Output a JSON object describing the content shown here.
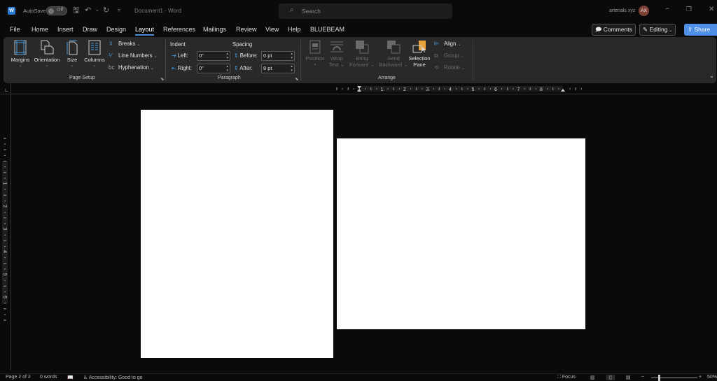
{
  "titlebar": {
    "app_logo": "W",
    "autosave_label": "AutoSave",
    "autosave_state": "Off",
    "save_icon": "save-icon",
    "undo_icon": "undo-icon",
    "redo_icon": "redo-icon",
    "customize_icon": "customize-qat-icon",
    "document_title": "Document1  -  Word",
    "search_placeholder": "Search",
    "username": "arterials xyz",
    "avatar_initials": "AX",
    "minimize_glyph": "−",
    "restore_glyph": "❐",
    "close_glyph": "✕"
  },
  "menu": {
    "tabs": [
      "File",
      "Home",
      "Insert",
      "Draw",
      "Design",
      "Layout",
      "References",
      "Mailings",
      "Review",
      "View",
      "Help",
      "BLUEBEAM"
    ],
    "active_tab": "Layout",
    "comments_label": "Comments",
    "editing_label": "Editing",
    "share_label": "Share"
  },
  "ribbon": {
    "page_setup": {
      "label": "Page Setup",
      "margins": "Margins",
      "orientation": "Orientation",
      "size": "Size",
      "columns": "Columns",
      "breaks": "Breaks",
      "line_numbers": "Line Numbers",
      "hyphenation": "Hyphenation"
    },
    "paragraph": {
      "label": "Paragraph",
      "indent_heading": "Indent",
      "spacing_heading": "Spacing",
      "left_label": "Left:",
      "left_value": "0\"",
      "right_label": "Right:",
      "right_value": "0\"",
      "before_label": "Before:",
      "before_value": "0 pt",
      "after_label": "After:",
      "after_value": "8 pt"
    },
    "arrange": {
      "label": "Arrange",
      "position": "Position",
      "wrap_text_1": "Wrap",
      "wrap_text_2": "Text",
      "bring_forward_1": "Bring",
      "bring_forward_2": "Forward",
      "send_backward_1": "Send",
      "send_backward_2": "Backward",
      "selection_pane_1": "Selection",
      "selection_pane_2": "Pane",
      "align": "Align",
      "group": "Group",
      "rotate": "Rotate"
    }
  },
  "rulers": {
    "horizontal_numbers": [
      "1",
      "2",
      "3",
      "4",
      "5",
      "6",
      "7",
      "8"
    ],
    "vertical_numbers": [
      "1",
      "2",
      "3",
      "4",
      "5",
      "6"
    ]
  },
  "statusbar": {
    "page": "Page 2 of 2",
    "words": "0 words",
    "accessibility": "Accessibility: Good to go",
    "focus": "Focus",
    "zoom_level": "50%",
    "zoom_minus": "−",
    "zoom_plus": "+"
  }
}
